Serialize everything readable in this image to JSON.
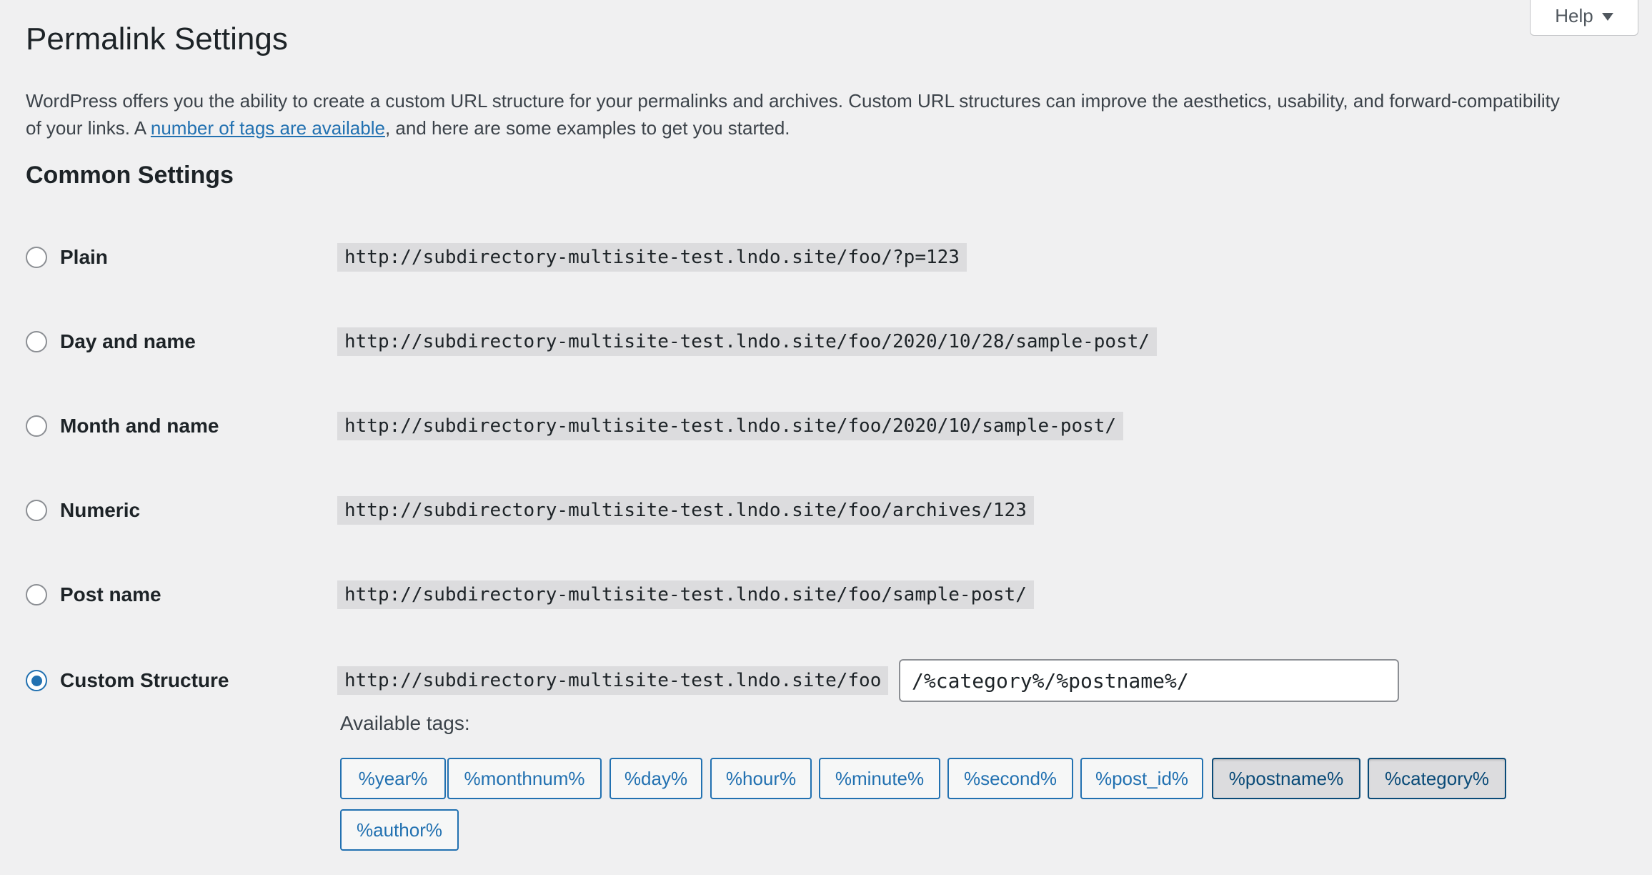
{
  "help": {
    "label": "Help"
  },
  "title": "Permalink Settings",
  "intro": {
    "before": "WordPress offers you the ability to create a custom URL structure for your permalinks and archives. Custom URL structures can improve the aesthetics, usability, and forward-compatibility of your links. A ",
    "link": "number of tags are available",
    "after": ", and here are some examples to get you started."
  },
  "common_settings": {
    "heading": "Common Settings",
    "options": [
      {
        "label": "Plain",
        "example": "http://subdirectory-multisite-test.lndo.site/foo/?p=123",
        "checked": false
      },
      {
        "label": "Day and name",
        "example": "http://subdirectory-multisite-test.lndo.site/foo/2020/10/28/sample-post/",
        "checked": false
      },
      {
        "label": "Month and name",
        "example": "http://subdirectory-multisite-test.lndo.site/foo/2020/10/sample-post/",
        "checked": false
      },
      {
        "label": "Numeric",
        "example": "http://subdirectory-multisite-test.lndo.site/foo/archives/123",
        "checked": false
      },
      {
        "label": "Post name",
        "example": "http://subdirectory-multisite-test.lndo.site/foo/sample-post/",
        "checked": false
      },
      {
        "label": "Custom Structure",
        "example": "http://subdirectory-multisite-test.lndo.site/foo",
        "checked": true
      }
    ],
    "custom_value": "/%category%/%postname%/",
    "available_tags_label": "Available tags:",
    "tags": [
      {
        "label": "%year%",
        "active": false
      },
      {
        "label": "%monthnum%",
        "active": false
      },
      {
        "label": "%day%",
        "active": false
      },
      {
        "label": "%hour%",
        "active": false
      },
      {
        "label": "%minute%",
        "active": false
      },
      {
        "label": "%second%",
        "active": false
      },
      {
        "label": "%post_id%",
        "active": false
      },
      {
        "label": "%postname%",
        "active": true
      },
      {
        "label": "%category%",
        "active": true
      },
      {
        "label": "%author%",
        "active": false
      }
    ]
  },
  "colors": {
    "accent": "#2271b1",
    "background": "#f0f0f1",
    "code_background": "#dcdcde"
  }
}
